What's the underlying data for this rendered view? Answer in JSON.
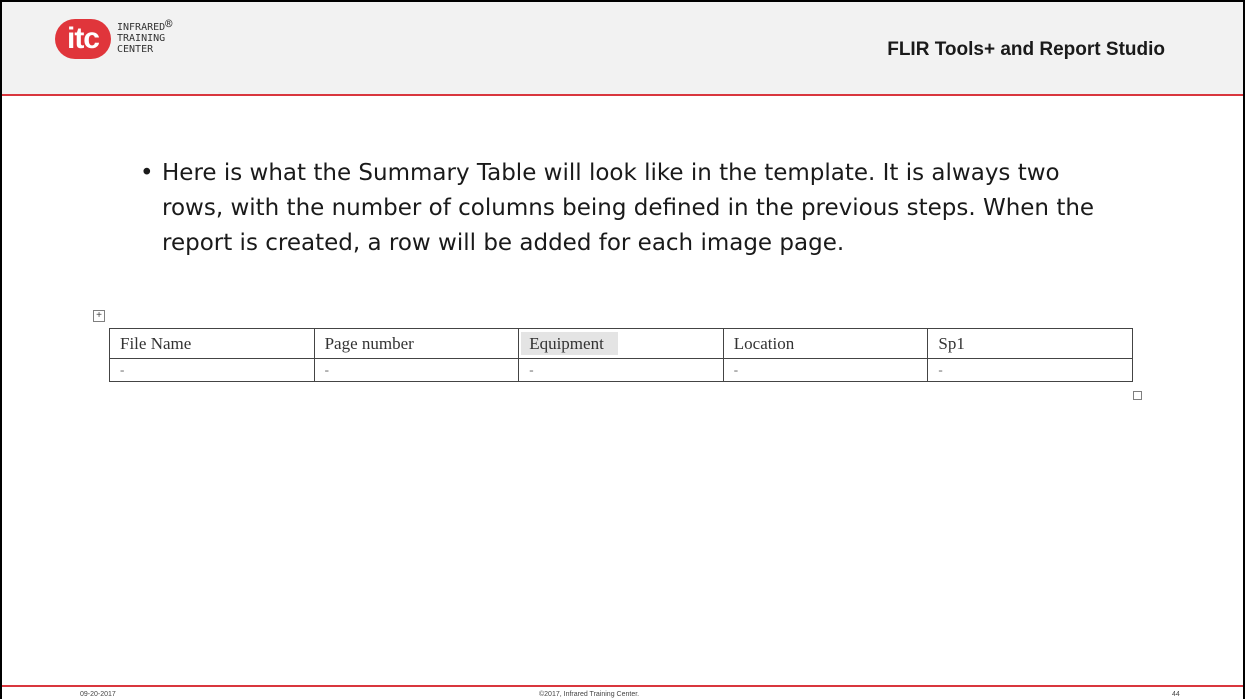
{
  "header": {
    "logo_mark": "itc",
    "logo_lines": [
      "INFRARED",
      "TRAINING",
      "CENTER"
    ],
    "logo_reg": "®",
    "title": "FLIR Tools+ and Report Studio",
    "accent_color": "#d9363e"
  },
  "body": {
    "bullet_char": "•",
    "bullet_text": "Here is what the Summary Table will look like in the template.  It is always two rows, with the number of columns being defined in the previous steps. When the report is created, a row will be added for each image page."
  },
  "table": {
    "headers": [
      "File Name",
      "Page number",
      "Equipment",
      "Location",
      "Sp1"
    ],
    "row": [
      "-",
      "-",
      "-",
      "-",
      "-"
    ]
  },
  "footer": {
    "date": "09-20-2017",
    "copyright": "©2017, Infrared Training Center.",
    "page": "44"
  }
}
